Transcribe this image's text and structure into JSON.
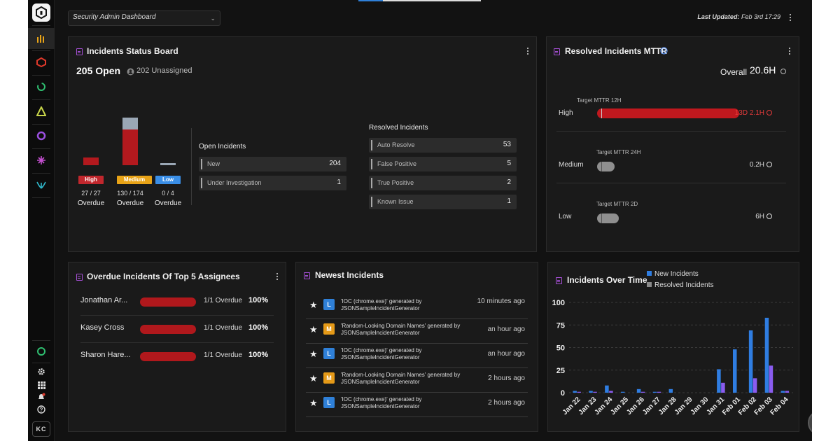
{
  "header": {
    "dashboard_select": "Security Admin Dashboard",
    "last_updated_label": "Last Updated:",
    "last_updated_value": "Feb 3rd 17:29"
  },
  "rail": {
    "avatar": "KC",
    "icons": [
      "app-logo-icon",
      "dashboards-icon",
      "cloud-security-icon",
      "network-icon",
      "alert-icon",
      "circle-app-icon",
      "star-app-icon",
      "leaf-app-icon",
      "status-icon",
      "settings-icon",
      "apps-grid-icon",
      "notifications-icon",
      "help-icon"
    ]
  },
  "status_board": {
    "title": "Incidents Status Board",
    "open": "205 Open",
    "unassigned": "202 Unassigned",
    "severities": [
      {
        "label": "High",
        "count": "27 / 27",
        "overdue": "Overdue",
        "color": "#c1272d",
        "overdue_n": 27,
        "total": 27
      },
      {
        "label": "Medium",
        "count": "130 / 174",
        "overdue": "Overdue",
        "color": "#e8a317",
        "overdue_n": 130,
        "total": 174
      },
      {
        "label": "Low",
        "count": "0 / 4",
        "overdue": "Overdue",
        "color": "#3a8ee6",
        "overdue_n": 0,
        "total": 4
      }
    ],
    "open_title": "Open Incidents",
    "open_rows": [
      {
        "label": "New",
        "value": "204"
      },
      {
        "label": "Under Investigation",
        "value": "1"
      }
    ],
    "resolved_title": "Resolved Incidents",
    "resolved_rows": [
      {
        "label": "Auto Resolve",
        "value": "53"
      },
      {
        "label": "False Positive",
        "value": "5"
      },
      {
        "label": "True Positive",
        "value": "2"
      },
      {
        "label": "Known Issue",
        "value": "1"
      }
    ]
  },
  "mttr": {
    "title": "Resolved Incidents MTTR",
    "overall_label": "Overall",
    "overall_value": "20.6H",
    "rows": [
      {
        "label": "High",
        "target": "Target MTTR 12H",
        "value": "13D 2.1H",
        "alert": true
      },
      {
        "label": "Medium",
        "target": "Target MTTR 24H",
        "value": "0.2H",
        "alert": false
      },
      {
        "label": "Low",
        "target": "Target MTTR 2D",
        "value": "6H",
        "alert": false
      }
    ]
  },
  "assignees": {
    "title": "Overdue Incidents Of Top 5 Assignees",
    "rows": [
      {
        "name": "Jonathan Ar...",
        "frac": "1/1 Overdue",
        "pct": "100%"
      },
      {
        "name": "Kasey Cross",
        "frac": "1/1 Overdue",
        "pct": "100%"
      },
      {
        "name": "Sharon Hare...",
        "frac": "1/1 Overdue",
        "pct": "100%"
      }
    ]
  },
  "newest": {
    "title": "Newest Incidents",
    "rows": [
      {
        "badge": "L",
        "line1": "'IOC (chrome.exe)' generated by",
        "line2": "JSONSampleIncidentGenerator",
        "time": "10 minutes ago"
      },
      {
        "badge": "M",
        "line1": "'Random-Looking Domain Names' generated by",
        "line2": "JSONSampleIncidentGenerator",
        "time": "an hour ago"
      },
      {
        "badge": "L",
        "line1": "'IOC (chrome.exe)' generated by",
        "line2": "JSONSampleIncidentGenerator",
        "time": "an hour ago"
      },
      {
        "badge": "M",
        "line1": "'Random-Looking Domain Names' generated by",
        "line2": "JSONSampleIncidentGenerator",
        "time": "2 hours ago"
      },
      {
        "badge": "L",
        "line1": "'IOC (chrome.exe)' generated by",
        "line2": "JSONSampleIncidentGenerator",
        "time": "2 hours ago"
      }
    ],
    "badge_colors": {
      "L": "#2f80d8",
      "M": "#e59a18"
    }
  },
  "chart_data": {
    "type": "bar",
    "title": "Incidents Over Time",
    "categories": [
      "Jan 22",
      "Jan 23",
      "Jan 24",
      "Jan 25",
      "Jan 26",
      "Jan 27",
      "Jan 28",
      "Jan 29",
      "Jan 30",
      "Jan 31",
      "Feb 01",
      "Feb 02",
      "Feb 03",
      "Feb 04"
    ],
    "series": [
      {
        "name": "New Incidents",
        "color": "#2f7de1",
        "values": [
          2,
          2,
          8,
          1,
          4,
          1,
          4,
          0,
          0,
          26,
          48,
          69,
          83,
          2
        ]
      },
      {
        "name": "Resolved Incidents",
        "color": "#8a8a8a",
        "values": [
          1,
          1,
          2,
          0,
          1,
          1,
          0,
          0,
          0,
          11,
          0,
          16,
          30,
          2
        ]
      }
    ],
    "yticks": [
      "0",
      "25",
      "50",
      "75",
      "100"
    ],
    "ylim": [
      0,
      100
    ],
    "grid": true,
    "legend": "top"
  }
}
